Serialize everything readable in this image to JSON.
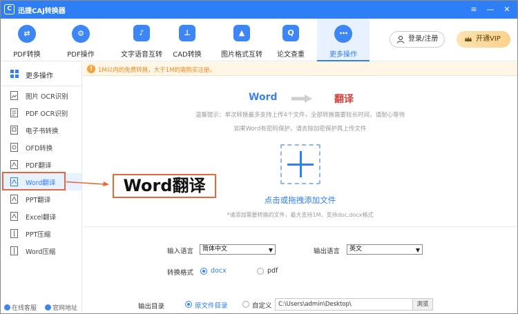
{
  "window": {
    "title": "迅捷CAJ转换器",
    "logo_text": "C",
    "controls": [
      "≡",
      "—",
      "✕"
    ]
  },
  "topnav": {
    "items": [
      {
        "label": "PDF转换",
        "icon": "exchange-icon",
        "glyph": "⇄"
      },
      {
        "label": "PDF操作",
        "icon": "gear-icon",
        "glyph": "⚙"
      },
      {
        "label": "文字语音互转",
        "icon": "text-voice-icon",
        "glyph": "♪"
      },
      {
        "label": "CAD转换",
        "icon": "cad-icon",
        "glyph": "⊥"
      },
      {
        "label": "图片格式互转",
        "icon": "image-icon",
        "glyph": "▲"
      },
      {
        "label": "论文查重",
        "icon": "paper-check-icon",
        "glyph": "Q"
      },
      {
        "label": "更多操作",
        "icon": "more-icon",
        "glyph": "•••",
        "active": true
      }
    ],
    "login_label": "登录/注册",
    "vip_label": "开通VIP"
  },
  "sidebar": {
    "header": "更多操作",
    "items": [
      {
        "label": "图片 OCR识别"
      },
      {
        "label": "PDF OCR识别"
      },
      {
        "label": "电子书转换"
      },
      {
        "label": "OFD转换"
      },
      {
        "label": "PDF翻译"
      },
      {
        "label": "Word翻译",
        "active": true
      },
      {
        "label": "PPT翻译"
      },
      {
        "label": "Excel翻译"
      },
      {
        "label": "PPT压缩"
      },
      {
        "label": "Word压缩"
      }
    ],
    "footer": {
      "service": "在线客服",
      "website": "官网地址"
    }
  },
  "notice": {
    "text": "1M以内的免费转换，大于1M的需购买注册。"
  },
  "main": {
    "flow_from": "Word",
    "flow_to": "翻译",
    "tip_line1": "温馨提示：单次转换最多支持上传4个文件，全部转换需要较长时间，请耐心等待",
    "tip_line2": "如果Word有密码保护，请去除加密保护再上传文件",
    "add_file_text": "点击或拖拽添加文件",
    "hint": "*请添加需要转换的文件，最大支持1M，支持doc,docx格式"
  },
  "options": {
    "input_lang_label": "输入语言",
    "input_lang_value": "简体中文",
    "output_lang_label": "输出语言",
    "output_lang_value": "英文",
    "format_label": "转换格式",
    "format_docx": "docx",
    "format_pdf": "pdf",
    "output_dir_label": "输出目录",
    "dir_original": "原文件目录",
    "dir_custom": "自定义",
    "path_value": "C:\\Users\\admin\\Desktop\\",
    "browse_label": "浏览"
  },
  "callout": {
    "text": "Word翻译"
  },
  "colors": {
    "accent": "#2e7ef6",
    "callout": "#e8663a",
    "notice_text": "#f08a22",
    "translate_red": "#d6403a"
  }
}
